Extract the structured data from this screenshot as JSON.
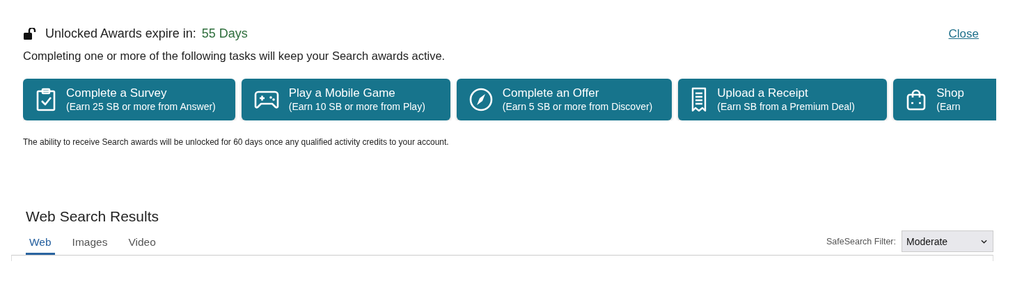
{
  "header": {
    "label": "Unlocked Awards expire in:",
    "value": "55 Days",
    "close": "Close"
  },
  "intro": "Completing one or more of the following tasks will keep your Search awards active.",
  "tasks": [
    {
      "kind": "survey",
      "title": "Complete a Survey",
      "subtitle": "(Earn 25 SB or more from Answer)"
    },
    {
      "kind": "game",
      "title": "Play a Mobile Game",
      "subtitle": "(Earn 10 SB or more from Play)"
    },
    {
      "kind": "offer",
      "title": "Complete an Offer",
      "subtitle": "(Earn 5 SB or more from Discover)"
    },
    {
      "kind": "receipt",
      "title": "Upload a Receipt",
      "subtitle": "(Earn SB from a Premium Deal)"
    },
    {
      "kind": "shop",
      "title": "Shop",
      "subtitle": "(Earn"
    }
  ],
  "note": "The ability to receive Search awards will be unlocked for 60 days once any qualified activity credits to your account.",
  "results": {
    "title": "Web Search Results",
    "tabs": [
      {
        "label": "Web",
        "selected": true
      },
      {
        "label": "Images",
        "selected": false
      },
      {
        "label": "Video",
        "selected": false
      }
    ],
    "safesearch": {
      "label": "SafeSearch Filter:",
      "value": "Moderate"
    }
  }
}
